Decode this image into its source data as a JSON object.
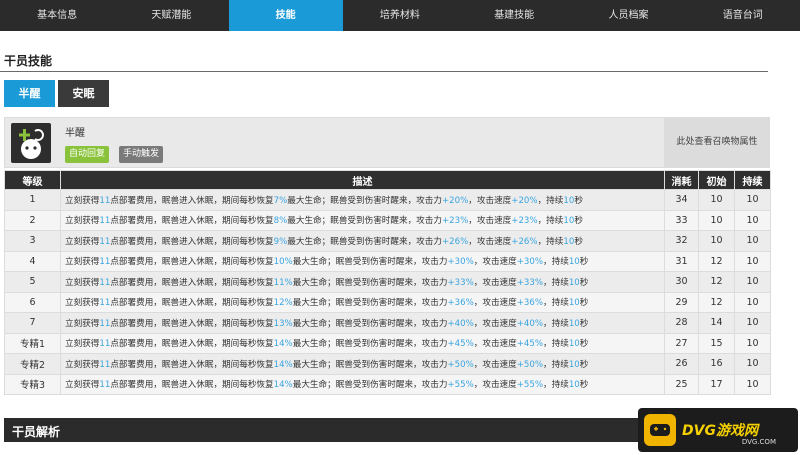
{
  "nav": {
    "tabs": [
      "基本信息",
      "天赋潜能",
      "技能",
      "培养材料",
      "基建技能",
      "人员档案",
      "语音台词"
    ],
    "active_index": 2
  },
  "section1": {
    "title": "干员技能"
  },
  "skill_tabs": {
    "items": [
      "半醒",
      "安眠"
    ],
    "active_index": 0
  },
  "skill": {
    "name": "半醒",
    "tags": [
      "自动回复",
      "手动触发"
    ],
    "summon_link": "此处查看召唤物属性"
  },
  "table": {
    "headers": [
      "等级",
      "描述",
      "消耗",
      "初始",
      "持续"
    ],
    "rows": [
      {
        "level": "1",
        "heal": "7%",
        "atk": "+20%",
        "spd": "+20%",
        "dur": "10",
        "cost": "34",
        "init": "10",
        "last": "10"
      },
      {
        "level": "2",
        "heal": "8%",
        "atk": "+23%",
        "spd": "+23%",
        "dur": "10",
        "cost": "33",
        "init": "10",
        "last": "10"
      },
      {
        "level": "3",
        "heal": "9%",
        "atk": "+26%",
        "spd": "+26%",
        "dur": "10",
        "cost": "32",
        "init": "10",
        "last": "10"
      },
      {
        "level": "4",
        "heal": "10%",
        "atk": "+30%",
        "spd": "+30%",
        "dur": "10",
        "cost": "31",
        "init": "12",
        "last": "10"
      },
      {
        "level": "5",
        "heal": "11%",
        "atk": "+33%",
        "spd": "+33%",
        "dur": "10",
        "cost": "30",
        "init": "12",
        "last": "10"
      },
      {
        "level": "6",
        "heal": "12%",
        "atk": "+36%",
        "spd": "+36%",
        "dur": "10",
        "cost": "29",
        "init": "12",
        "last": "10"
      },
      {
        "level": "7",
        "heal": "13%",
        "atk": "+40%",
        "spd": "+40%",
        "dur": "10",
        "cost": "28",
        "init": "14",
        "last": "10"
      },
      {
        "level": "专精1",
        "heal": "14%",
        "atk": "+45%",
        "spd": "+45%",
        "dur": "10",
        "cost": "27",
        "init": "15",
        "last": "10"
      },
      {
        "level": "专精2",
        "heal": "14%",
        "atk": "+50%",
        "spd": "+50%",
        "dur": "10",
        "cost": "26",
        "init": "16",
        "last": "10"
      },
      {
        "level": "专精3",
        "heal": "14%",
        "atk": "+55%",
        "spd": "+55%",
        "dur": "10",
        "cost": "25",
        "init": "17",
        "last": "10"
      }
    ],
    "desc_parts": {
      "p1": "立刻获得",
      "n1": "11",
      "p2": "点部署费用，眠兽进入休眠，期间每秒恢复",
      "p3": "最大生命；眠兽受到伤害时醒来，攻击力",
      "p4": "，攻击速度",
      "p5": "，持续",
      "p6": "秒"
    }
  },
  "section2": {
    "title": "干员解析"
  },
  "watermark": {
    "text": "DVG游戏网",
    "sub": "DVG.COM"
  },
  "colors": {
    "accent": "#1a9ad6",
    "highlight": "#3aa5e0",
    "nav_bg": "#2b2b2b"
  }
}
